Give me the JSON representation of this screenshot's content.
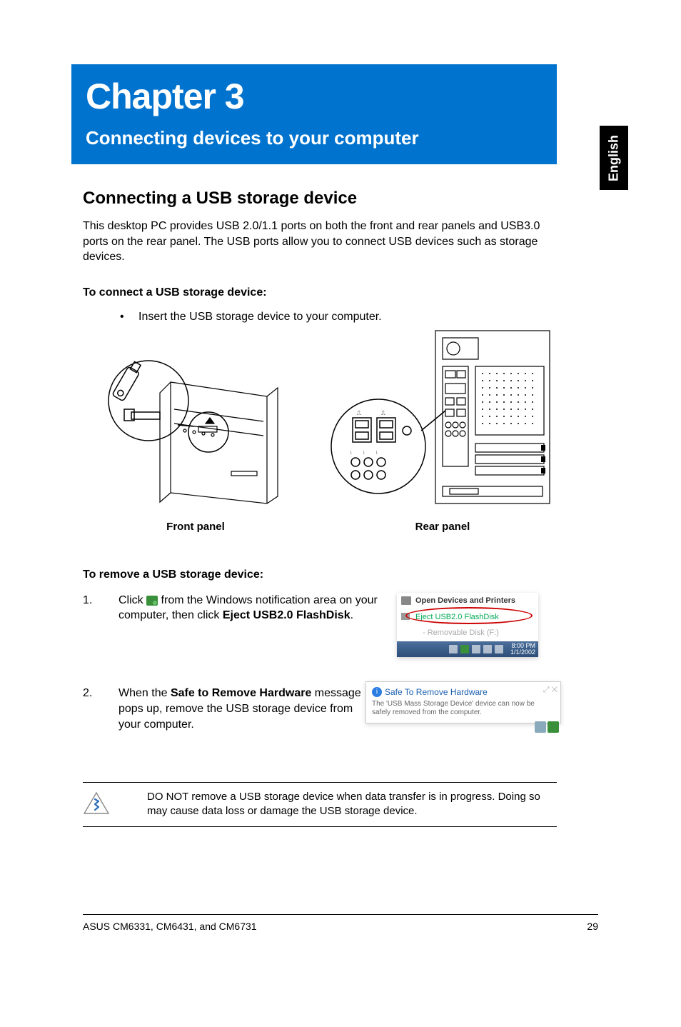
{
  "side_tab": "English",
  "chapter": {
    "title": "Chapter 3",
    "subtitle": "Connecting devices to your computer"
  },
  "section_heading": "Connecting a USB storage device",
  "intro": "This desktop PC provides USB 2.0/1.1 ports on both the front and rear panels and USB3.0 ports on the rear panel. The USB ports allow you to connect USB devices such as storage devices.",
  "connect_heading": "To connect a USB storage device:",
  "bullet": "Insert the USB storage device to your computer.",
  "fig1_caption": "Front panel",
  "fig2_caption": "Rear panel",
  "remove_heading": "To remove a USB storage device:",
  "step1": {
    "num": "1.",
    "pre": "Click ",
    "post1": " from the Windows notification area on your computer, then click ",
    "bold": "Eject USB2.0 FlashDisk",
    "post2": "."
  },
  "popup1": {
    "open_devices": "Open Devices and Printers",
    "eject": "Eject USB2.0 FlashDisk",
    "removable": "Removable Disk (F:)",
    "clock_time": "8:00 PM",
    "clock_date": "1/1/2002"
  },
  "step2": {
    "num": "2.",
    "pre": "When the ",
    "bold": "Safe to Remove Hardware",
    "post": " message pops up, remove the USB storage device from your computer."
  },
  "popup2": {
    "title": "Safe To Remove Hardware",
    "msg": "The 'USB Mass Storage Device' device can now be safely removed from the computer."
  },
  "note": "DO NOT remove a USB storage device when data transfer is in progress. Doing so may cause data loss or damage the USB storage device.",
  "footer_left": "ASUS CM6331, CM6431, and CM6731",
  "footer_right": "29"
}
